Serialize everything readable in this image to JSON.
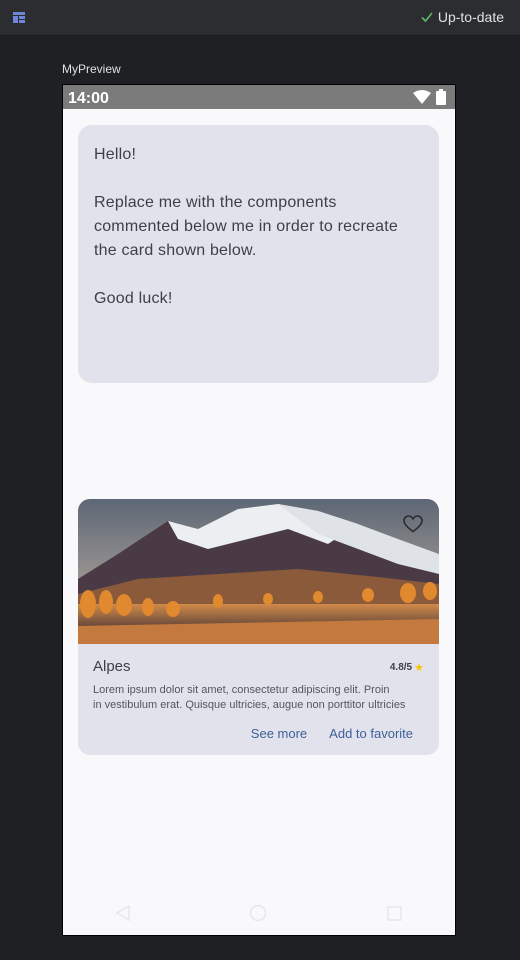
{
  "ide": {
    "status_text": "Up-to-date",
    "preview_name": "MyPreview"
  },
  "device": {
    "time": "14:00"
  },
  "hello_card": {
    "line1": "Hello!",
    "line2": "Replace me with the components commented below me in order to recreate the card shown below.",
    "line3": "Good luck!"
  },
  "place_card": {
    "title": "Alpes",
    "rating": "4.8/5",
    "description_line1": "Lorem ipsum dolor sit amet, consectetur adipiscing elit. Proin",
    "description_line2": "in vestibulum erat. Quisque ultricies, augue non porttitor ultricies",
    "see_more_label": "See more",
    "favorite_label": "Add to favorite"
  },
  "colors": {
    "card_bg": "#e2e2ec",
    "accent": "#3d5f99",
    "star": "#f6c800"
  },
  "icons": {
    "layout": "layout-icon",
    "status": "check-icon",
    "favorite": "heart-outline-icon",
    "rating": "star-icon",
    "nav_back": "triangle-back-icon",
    "nav_home": "circle-home-icon",
    "nav_recents": "square-recents-icon"
  }
}
